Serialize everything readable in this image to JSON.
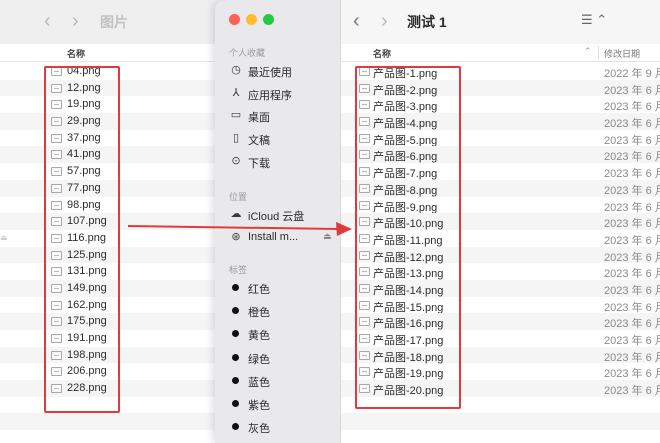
{
  "left_window": {
    "title": "图片",
    "back_icon": "chevron-left-icon",
    "forward_icon": "chevron-right-icon",
    "column_name": "名称",
    "files": [
      "04.png",
      "12.png",
      "19.png",
      "29.png",
      "37.png",
      "41.png",
      "57.png",
      "77.png",
      "98.png",
      "107.png",
      "116.png",
      "125.png",
      "131.png",
      "149.png",
      "162.png",
      "175.png",
      "191.png",
      "198.png",
      "206.png",
      "228.png"
    ]
  },
  "sidebar": {
    "favorites_label": "个人收藏",
    "favorites": [
      {
        "label": "最近使用",
        "icon": "clock-icon"
      },
      {
        "label": "应用程序",
        "icon": "apps-icon"
      },
      {
        "label": "桌面",
        "icon": "desktop-icon"
      },
      {
        "label": "文稿",
        "icon": "document-icon"
      },
      {
        "label": "下载",
        "icon": "download-icon"
      }
    ],
    "locations_label": "位置",
    "locations": [
      {
        "label": "iCloud 云盘",
        "icon": "cloud-icon"
      },
      {
        "label": "Install m...",
        "icon": "disk-icon"
      }
    ],
    "tags_label": "标签",
    "tags": [
      {
        "label": "红色"
      },
      {
        "label": "橙色"
      },
      {
        "label": "黄色"
      },
      {
        "label": "绿色"
      },
      {
        "label": "蓝色"
      },
      {
        "label": "紫色"
      },
      {
        "label": "灰色"
      }
    ],
    "traffic_colors": {
      "close": "#fe5f57",
      "minimize": "#febc2e",
      "zoom": "#28c840"
    }
  },
  "right_window": {
    "title": "测试 1",
    "column_name": "名称",
    "column_date": "修改日期",
    "files": [
      {
        "name": "产品图-1.png",
        "date": "2022 年 9 月"
      },
      {
        "name": "产品图-2.png",
        "date": "2023 年 6 月"
      },
      {
        "name": "产品图-3.png",
        "date": "2023 年 6 月"
      },
      {
        "name": "产品图-4.png",
        "date": "2023 年 6 月"
      },
      {
        "name": "产品图-5.png",
        "date": "2023 年 6 月"
      },
      {
        "name": "产品图-6.png",
        "date": "2023 年 6 月"
      },
      {
        "name": "产品图-7.png",
        "date": "2023 年 6 月"
      },
      {
        "name": "产品图-8.png",
        "date": "2023 年 6 月"
      },
      {
        "name": "产品图-9.png",
        "date": "2023 年 6 月"
      },
      {
        "name": "产品图-10.png",
        "date": "2023 年 6 月"
      },
      {
        "name": "产品图-11.png",
        "date": "2023 年 6 月"
      },
      {
        "name": "产品图-12.png",
        "date": "2023 年 6 月"
      },
      {
        "name": "产品图-13.png",
        "date": "2023 年 6 月"
      },
      {
        "name": "产品图-14.png",
        "date": "2023 年 6 月"
      },
      {
        "name": "产品图-15.png",
        "date": "2023 年 6 月"
      },
      {
        "name": "产品图-16.png",
        "date": "2023 年 6 月"
      },
      {
        "name": "产品图-17.png",
        "date": "2023 年 6 月"
      },
      {
        "name": "产品图-18.png",
        "date": "2023 年 6 月"
      },
      {
        "name": "产品图-19.png",
        "date": "2023 年 6 月"
      },
      {
        "name": "产品图-20.png",
        "date": "2023 年 6 月"
      }
    ]
  },
  "annotation_color": "#e03a3e"
}
